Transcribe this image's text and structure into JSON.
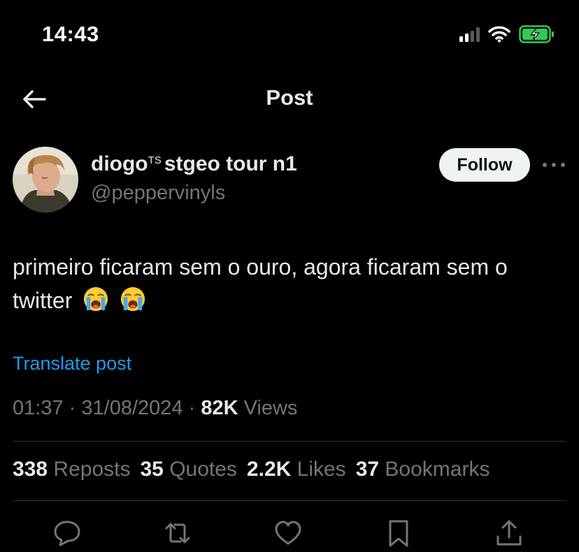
{
  "status_bar": {
    "time": "14:43",
    "signal_icon": "cellular-signal-icon",
    "wifi_icon": "wifi-icon",
    "battery_icon": "battery-charging-icon",
    "battery_color": "#34c759"
  },
  "nav": {
    "title": "Post",
    "back_icon": "back-arrow-icon"
  },
  "author": {
    "name_prefix": "diogo",
    "name_super": "TS",
    "name_suffix": "stgeo tour n1",
    "handle": "@peppervinyls",
    "follow_label": "Follow",
    "more_icon": "more-options-icon"
  },
  "post": {
    "text": "primeiro ficaram sem o ouro, agora ficaram sem o twitter",
    "emoji": [
      "loudly-crying-face-icon",
      "loudly-crying-face-icon"
    ],
    "translate_label": "Translate post",
    "time": "01:37",
    "sep1": "·",
    "date": "31/08/2024",
    "sep2": "·",
    "views_count": "82K",
    "views_label": "Views"
  },
  "stats": {
    "reposts_count": "338",
    "reposts_label": "Reposts",
    "quotes_count": "35",
    "quotes_label": "Quotes",
    "likes_count": "2.2K",
    "likes_label": "Likes",
    "bookmarks_count": "37",
    "bookmarks_label": "Bookmarks"
  },
  "actions": [
    "reply-icon",
    "repost-icon",
    "like-icon",
    "bookmark-icon",
    "share-icon"
  ],
  "colors": {
    "link": "#1d9bf0",
    "muted": "#71767b",
    "text": "#e7e9ea",
    "background": "#000000"
  }
}
